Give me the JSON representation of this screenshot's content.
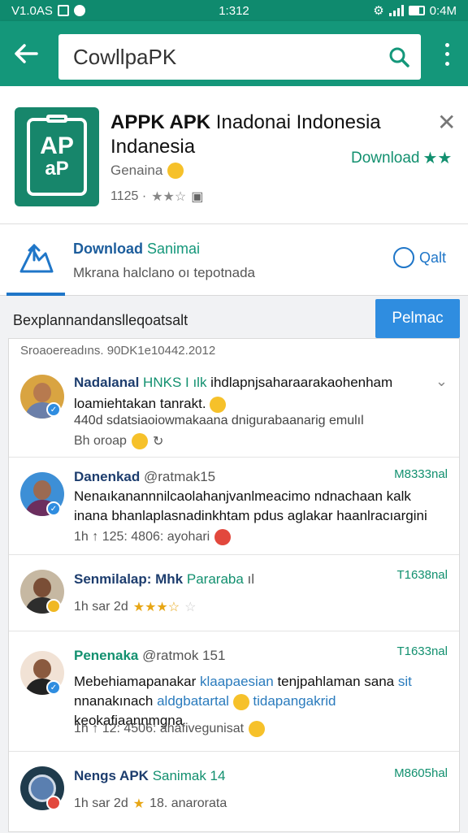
{
  "status": {
    "left_text": "V1.0AS",
    "time": "1:312",
    "right_text": "0:4M"
  },
  "search": {
    "query": "CowllpaPK"
  },
  "app": {
    "title_bold": "APPK APK",
    "title_rest": " Inadonai Indonesia",
    "title_line2": "Indanesia",
    "icon_line1": "AP",
    "icon_line2": "aP",
    "subtitle": "Genaina",
    "meta": "1125 ·",
    "download_label": "Download"
  },
  "download_row": {
    "title": "Download",
    "title_tag": "Sanimai",
    "subtitle": "Mkrana halclano oı tepotnada",
    "right_label": "Qalt"
  },
  "section": {
    "title": "Bexplannandanslleqoatsalt",
    "button_label": "Pelmac",
    "caption": "Sroaoereadıns. 90DK1e10442.2012"
  },
  "posts": [
    {
      "name": "Nadalanal",
      "tag": "HNKS I ılk",
      "name_rest": " ihdlapnjsaharaarakaohenham",
      "text_line2": "loamiehtakan tanrakt.",
      "sub": "440d sdatsiaoiowmakaana dnigurabaanarig emulıl",
      "meta": "Bh  oroap"
    },
    {
      "name": "Danenkad",
      "handle": "@ratmak15",
      "time": "M8333nal",
      "text_line1": "Nenaıkanannnilcaolahanjvanlmeacimo ndnachaan kalk",
      "text_line2": "inana  bhanlaplasnadinkhtam pdus aglakar haanlracıargini",
      "meta": "1h  ↑  125: 4806: ayohari"
    },
    {
      "name": "Senmilalap: Mhk",
      "tag": "Pararaba",
      "tag_rest": " ıl",
      "time": "T1638nal",
      "meta": "1h  sar 2d"
    },
    {
      "name": "Penenaka",
      "handle": "@ratmok 151",
      "time": "T1633nal",
      "text_line1a": "Mebehiamapanakar ",
      "text_line1_link": "klaapaesian",
      "text_line1b": " tenjpahlaman sana ",
      "text_line1_link2": "sit",
      "text_line2a": "nnanakınach ",
      "text_line2_link": "aldgbatartal",
      "text_line2_link2": " tidapangakrid",
      "text_line2b": "keokafiaannmgna",
      "meta": "1h  ↑  12: 4506: ahafivegunisat"
    },
    {
      "name": "Nengs APK",
      "handle": "Sanimak 14",
      "time": "M8605hal",
      "meta": "1h  sar 2d",
      "meta_rest": "18. anarorata"
    }
  ],
  "colors": {
    "brand": "#14977a",
    "accent": "#2f8de0",
    "link": "#1f76c8"
  }
}
